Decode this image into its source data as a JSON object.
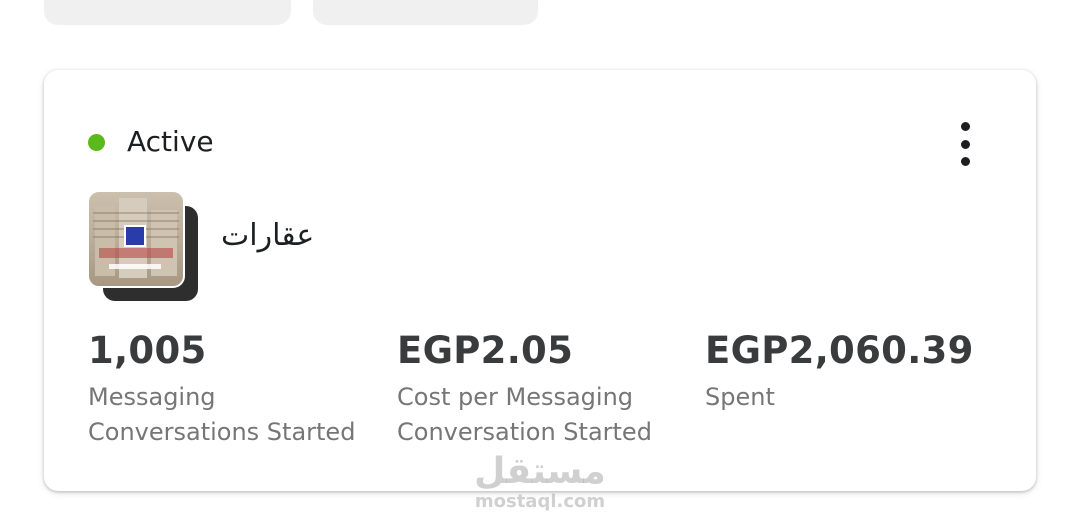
{
  "card": {
    "status": {
      "label": "Active",
      "color": "#5cb91c"
    },
    "more_menu_icon": "more-vertical-icon",
    "campaign": {
      "name": "عقارات",
      "thumbnail": "property-ad-thumbnail"
    },
    "metrics": [
      {
        "value": "1,005",
        "label": "Messaging Conversations Started"
      },
      {
        "value": "EGP2.05",
        "label": "Cost per Messaging Conversation Started"
      },
      {
        "value": "EGP2,060.39",
        "label": "Spent"
      }
    ]
  },
  "watermark": {
    "arabic": "مستقل",
    "latin": "mostaql.com"
  }
}
